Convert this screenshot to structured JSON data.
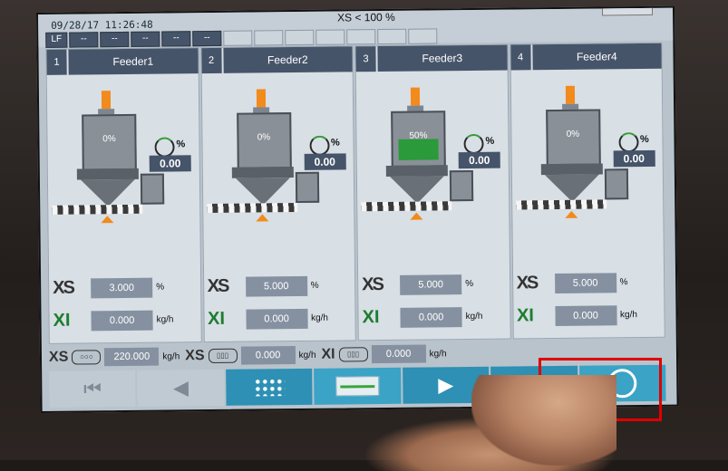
{
  "status": {
    "datetime": "09/28/17 11:26:48",
    "alarm": "XS < 100 %"
  },
  "indicators": [
    "LF",
    "--",
    "--",
    "--",
    "--",
    "--"
  ],
  "feeders": [
    {
      "num": "1",
      "name": "Feeder1",
      "fill_pct": "0%",
      "fill": 0.0,
      "ratio": "0.00",
      "ratio_unit": "%",
      "xs_label": "XS",
      "xs_value": "3.000",
      "xs_unit": "%",
      "xi_label": "XI",
      "xi_value": "0.000",
      "xi_unit": "kg/h"
    },
    {
      "num": "2",
      "name": "Feeder2",
      "fill_pct": "0%",
      "fill": 0.0,
      "ratio": "0.00",
      "ratio_unit": "%",
      "xs_label": "XS",
      "xs_value": "5.000",
      "xs_unit": "%",
      "xi_label": "XI",
      "xi_value": "0.000",
      "xi_unit": "kg/h"
    },
    {
      "num": "3",
      "name": "Feeder3",
      "fill_pct": "50%",
      "fill": 0.5,
      "ratio": "0.00",
      "ratio_unit": "%",
      "xs_label": "XS",
      "xs_value": "5.000",
      "xs_unit": "%",
      "xi_label": "XI",
      "xi_value": "0.000",
      "xi_unit": "kg/h"
    },
    {
      "num": "4",
      "name": "Feeder4",
      "fill_pct": "0%",
      "fill": 0.0,
      "ratio": "0.00",
      "ratio_unit": "%",
      "xs_label": "XS",
      "xs_value": "5.000",
      "xs_unit": "%",
      "xi_label": "XI",
      "xi_value": "0.000",
      "xi_unit": "kg/h"
    }
  ],
  "totals": [
    {
      "label": "XS",
      "value": "220.000",
      "unit": "kg/h"
    },
    {
      "label": "XS",
      "value": "0.000",
      "unit": "kg/h"
    },
    {
      "label": "XI",
      "value": "0.000",
      "unit": "kg/h"
    }
  ],
  "nav": [
    "skip-back-icon",
    "prev-icon",
    "grid-icon",
    "trend-icon",
    "play-icon",
    "skip-forward-icon",
    "power-icon"
  ]
}
